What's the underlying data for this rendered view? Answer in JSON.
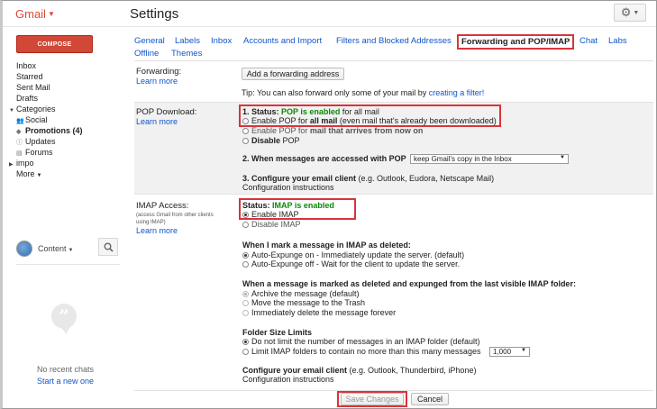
{
  "header": {
    "logo": "Gmail",
    "title": "Settings"
  },
  "sidebar": {
    "compose": "COMPOSE",
    "items": [
      {
        "label": "Inbox"
      },
      {
        "label": "Starred"
      },
      {
        "label": "Sent Mail"
      },
      {
        "label": "Drafts"
      },
      {
        "label": "Categories"
      },
      {
        "label": "Social"
      },
      {
        "label": "Promotions (4)"
      },
      {
        "label": "Updates"
      },
      {
        "label": "Forums"
      },
      {
        "label": "impo"
      },
      {
        "label": "More"
      }
    ]
  },
  "chat": {
    "status": "Content",
    "empty": "No recent chats",
    "start": "Start a new one"
  },
  "tabs": [
    {
      "label": "General"
    },
    {
      "label": "Labels"
    },
    {
      "label": "Inbox"
    },
    {
      "label": "Accounts and Import"
    },
    {
      "label": "Filters and Blocked Addresses"
    },
    {
      "label": "Forwarding and POP/IMAP"
    },
    {
      "label": "Chat"
    },
    {
      "label": "Labs"
    },
    {
      "label": "Offline"
    },
    {
      "label": "Themes"
    }
  ],
  "forwarding": {
    "label": "Forwarding:",
    "learn": "Learn more",
    "add_button": "Add a forwarding address",
    "tip_prefix": "Tip: You can also forward only some of your mail by ",
    "tip_link": "creating a filter!"
  },
  "pop": {
    "label": "POP Download:",
    "learn": "Learn more",
    "status_prefix": "1. Status: ",
    "status_value": "POP is enabled",
    "status_suffix": " for all mail",
    "opt1_a": "Enable POP for ",
    "opt1_b": "all mail",
    "opt1_c": " (even mail that's already been downloaded)",
    "opt2_a": "Enable POP for ",
    "opt2_b": "mail that arrives from now on",
    "opt3_a": "Disable",
    "opt3_b": " POP",
    "step2": "2. When messages are accessed with POP",
    "step2_select": "keep Gmail's copy in the Inbox",
    "step3": "3. Configure your email client",
    "step3_note": " (e.g. Outlook, Eudora, Netscape Mail)",
    "step3_link": "Configuration instructions"
  },
  "imap": {
    "label": "IMAP Access:",
    "note": "(access Gmail from other clients using IMAP)",
    "learn": "Learn more",
    "status_prefix": "Status: ",
    "status_value": "IMAP is enabled",
    "enable": "Enable IMAP",
    "disable": "Disable IMAP",
    "deleted_heading": "When I mark a message in IMAP as deleted:",
    "expunge_on": "Auto-Expunge on - Immediately update the server. (default)",
    "expunge_off": "Auto-Expunge off - Wait for the client to update the server.",
    "expunged_heading": "When a message is marked as deleted and expunged from the last visible IMAP folder:",
    "archive": "Archive the message (default)",
    "trash": "Move the message to the Trash",
    "delete_forever": "Immediately delete the message forever",
    "folder_heading": "Folder Size Limits",
    "no_limit": "Do not limit the number of messages in an IMAP folder (default)",
    "limit": "Limit IMAP folders to contain no more than this many messages",
    "limit_value": "1,000",
    "configure_a": "Configure your email client",
    "configure_b": " (e.g. Outlook, Thunderbird, iPhone)",
    "configure_link": "Configuration instructions"
  },
  "footer": {
    "save": "Save Changes",
    "cancel": "Cancel"
  },
  "colors": {
    "accent_red": "#d9343a",
    "compose": "#d14836",
    "link": "#1155cc",
    "enabled_green": "#0a8a0a"
  }
}
